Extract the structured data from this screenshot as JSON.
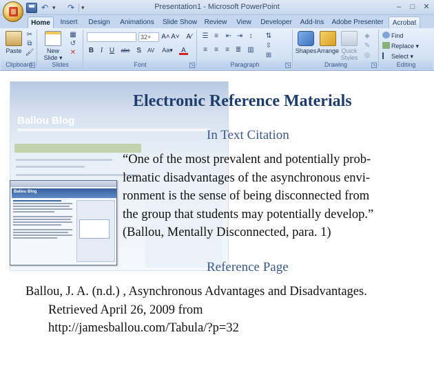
{
  "window": {
    "title": "Presentation1 - Microsoft PowerPoint",
    "controls": {
      "minimize": "–",
      "maximize": "□",
      "close": "✕"
    }
  },
  "quick_access": {
    "undo_glyph": "↶",
    "redo_glyph": "↷",
    "more_glyph": "▾"
  },
  "tabs": [
    {
      "label": "Home",
      "active": true
    },
    {
      "label": "Insert"
    },
    {
      "label": "Design"
    },
    {
      "label": "Animations"
    },
    {
      "label": "Slide Show"
    },
    {
      "label": "Review"
    },
    {
      "label": "View"
    },
    {
      "label": "Developer"
    },
    {
      "label": "Add-Ins"
    },
    {
      "label": "Adobe Presenter"
    },
    {
      "label": "Acrobat"
    }
  ],
  "ribbon": {
    "groups": {
      "clipboard": "Clipboard",
      "slides": "Slides",
      "font": "Font",
      "paragraph": "Paragraph",
      "drawing": "Drawing",
      "editing": "Editing"
    },
    "clipboard": {
      "paste": "Paste"
    },
    "slides": {
      "new_slide_line1": "New",
      "new_slide_line2": "Slide ▾"
    },
    "font": {
      "size": "32+",
      "grow": "A˄",
      "shrink": "A˅",
      "clear": "A⁄",
      "bold": "B",
      "italic": "I",
      "underline": "U",
      "strike": "abc",
      "shadow": "S",
      "spacing": "AV",
      "case": "Aa▾",
      "color": "A"
    },
    "drawing": {
      "shapes": "Shapes",
      "arrange": "Arrange",
      "quick_styles_line1": "Quick",
      "quick_styles_line2": "Styles ▾"
    },
    "editing": {
      "find": "Find",
      "replace": "Replace ▾",
      "select": "Select ▾"
    },
    "colors": {
      "accent": "#1f3d6b",
      "ribbon": "#d6e4f5"
    }
  },
  "slide": {
    "title": "Electronic Reference Materials",
    "subtitle_citation": "In Text Citation",
    "quote_lines": [
      "“One of the most prevalent and potentially prob-",
      "lematic disadvantages of the asynchronous envi-",
      "ronment is the sense of being disconnected from",
      "the group that students may potentially develop.”",
      "(Ballou, Mentally Disconnected, para. 1)"
    ],
    "subtitle_reference": "Reference Page",
    "reference_lines": [
      "Ballou, J. A. (n.d.) , Asynchronous Advantages and Disadvantages.",
      "Retrieved April 26, 2009 from",
      "http://jamesballou.com/Tabula/?p=32"
    ],
    "background_blog_title": "Ballou Blog",
    "thumbnail_blog_title": "Ballou Blog"
  }
}
